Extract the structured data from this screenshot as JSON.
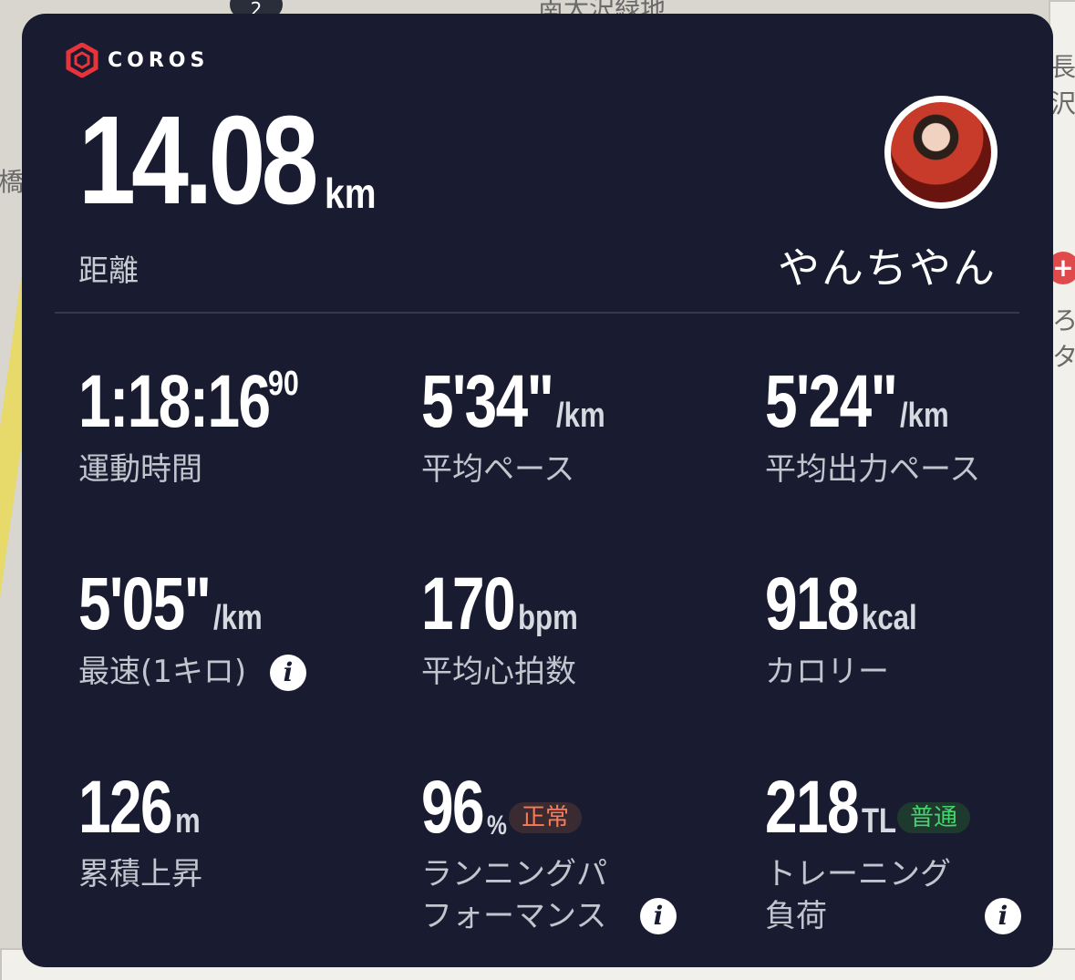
{
  "map": {
    "labels": [
      "南大沢緑地",
      "長沢",
      "橋本",
      "ろ",
      "タ"
    ],
    "badge": "2",
    "pin": "+"
  },
  "brand": {
    "logo_text": "COROS",
    "logo_color": "#e8333a"
  },
  "summary": {
    "distance_value": "14.08",
    "distance_unit": "km",
    "distance_label": "距離",
    "username": "やんちやん"
  },
  "metrics": [
    {
      "value": "1:18:16",
      "sup": "90",
      "label": "運動時間"
    },
    {
      "value": "5'34\"",
      "unit": "/km",
      "label": "平均ペース"
    },
    {
      "value": "5'24\"",
      "unit": "/km",
      "label": "平均出力ペース"
    },
    {
      "value": "5'05\"",
      "unit": "/km",
      "label": "最速(1キロ)",
      "info": "i"
    },
    {
      "value": "170",
      "unit": "bpm",
      "label": "平均心拍数"
    },
    {
      "value": "918",
      "unit": "kcal",
      "label": "カロリー"
    },
    {
      "value": "126",
      "unit": "m",
      "label": "累積上昇"
    },
    {
      "value": "96",
      "unit": "%",
      "badge": "正常",
      "label_line1": "ランニングパ",
      "label_line2": "フォーマンス",
      "info": "i"
    },
    {
      "value": "218",
      "unit": "TL",
      "badge": "普通",
      "label_line1": "トレーニング",
      "label_line2": "負荷",
      "info": "i"
    }
  ],
  "colors": {
    "card_bg": "#191c30",
    "badge_warn": "#ff7a52",
    "badge_ok": "#47d46f"
  }
}
